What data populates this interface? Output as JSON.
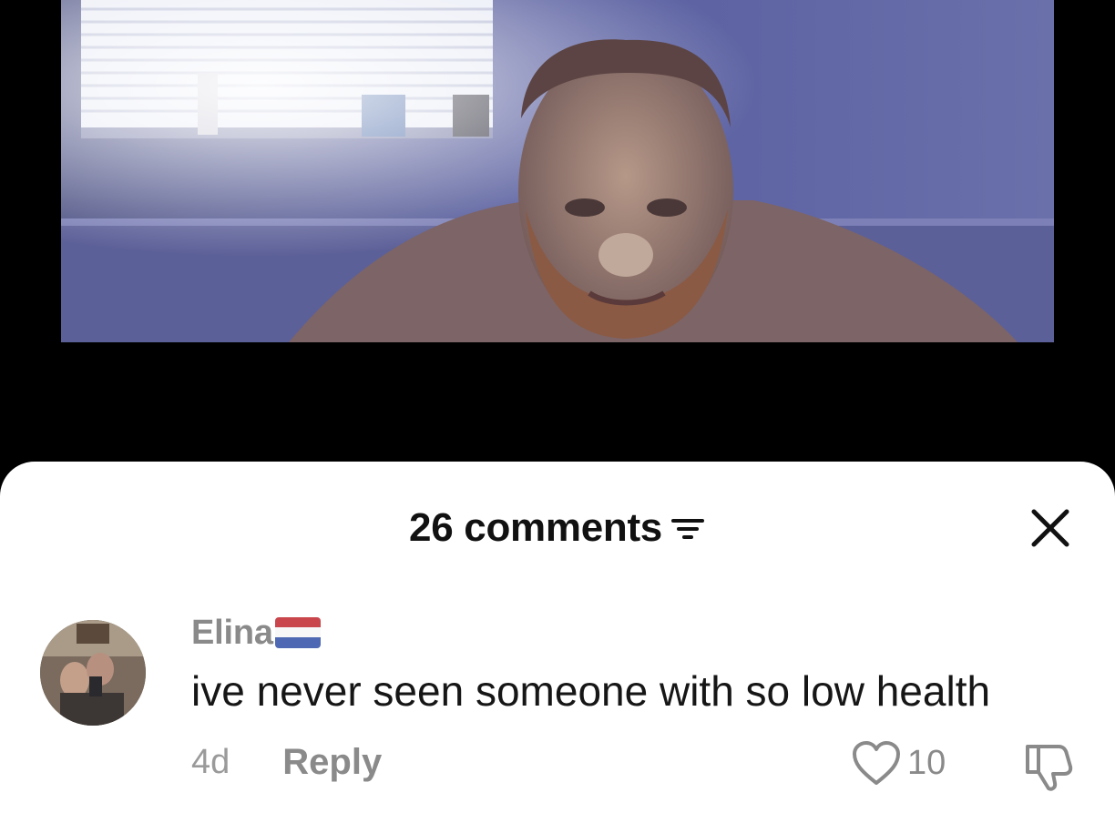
{
  "video": {
    "scene_icon": "video-frame"
  },
  "comments_sheet": {
    "title": "26 comments",
    "sort_icon": "sort-filter-icon",
    "close_icon": "close-icon"
  },
  "comment": {
    "username": "Elina",
    "flag_icon": "netherlands-flag-icon",
    "text": "ive never seen someone with so low health",
    "time": "4d",
    "reply_label": "Reply",
    "like_count": "10",
    "like_icon": "heart-icon",
    "dislike_icon": "dislike-icon"
  },
  "colors": {
    "sheet_background": "#ffffff",
    "page_background": "#000000",
    "muted_text": "#8a8a8a",
    "primary_text": "#161616"
  }
}
